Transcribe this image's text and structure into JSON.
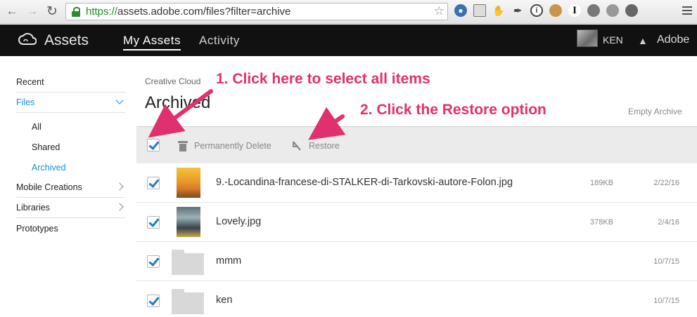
{
  "browser": {
    "url_scheme": "https://",
    "url_rest": "assets.adobe.com/files?filter=archive",
    "extension_icons": [
      "globe-icon",
      "photo-icon",
      "hand-icon",
      "pen-icon",
      "info-icon",
      "cookie-icon",
      "text-cursor-icon",
      "circle-icon",
      "cat-icon",
      "lock-icon"
    ]
  },
  "header": {
    "app_title": "Assets",
    "tabs": [
      {
        "label": "My Assets"
      },
      {
        "label": "Activity"
      }
    ],
    "user_name": "KEN",
    "brand_label": "Adobe"
  },
  "sidebar": {
    "items": [
      {
        "label": "Recent"
      },
      {
        "label": "Files"
      },
      {
        "label": "All"
      },
      {
        "label": "Shared"
      },
      {
        "label": "Archived"
      },
      {
        "label": "Mobile Creations"
      },
      {
        "label": "Libraries"
      },
      {
        "label": "Prototypes"
      }
    ]
  },
  "main": {
    "breadcrumb": "Creative Cloud",
    "title": "Archived",
    "empty_archive_label": "Empty Archive",
    "toolbar": {
      "delete_label": "Permanently Delete",
      "restore_label": "Restore"
    },
    "files": [
      {
        "name": "9.-Locandina-francese-di-STALKER-di-Tarkovski-autore-Folon.jpg",
        "size": "189KB",
        "date": "2/22/16"
      },
      {
        "name": "Lovely.jpg",
        "size": "378KB",
        "date": "2/4/16"
      },
      {
        "name": "mmm",
        "size": "",
        "date": "10/7/15"
      },
      {
        "name": "ken",
        "size": "",
        "date": "10/7/15"
      }
    ]
  },
  "annotations": {
    "step1": "1. Click here to select all items",
    "step2": "2. Click the Restore option",
    "color": "#e0306f"
  },
  "colors": {
    "accent_blue": "#1b8fd0",
    "header_bg": "#111111",
    "url_green": "#1e8a1e"
  }
}
